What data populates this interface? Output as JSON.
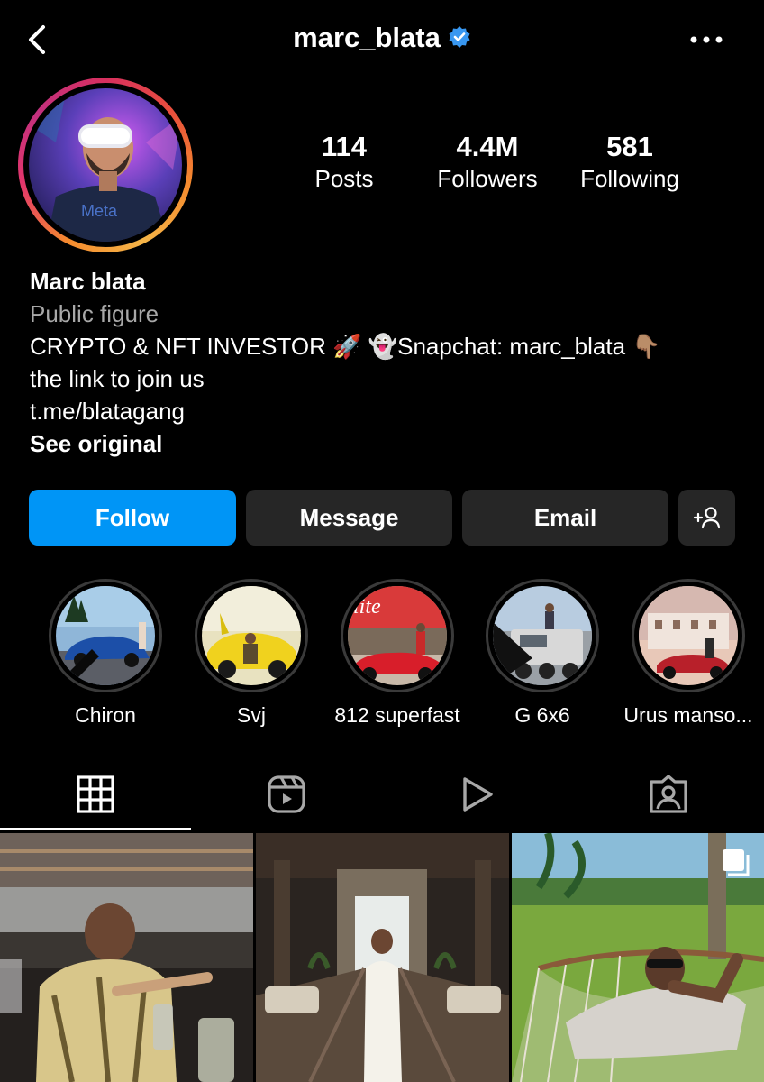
{
  "header": {
    "username": "marc_blata",
    "back_icon": "chevron-left-icon",
    "verified_icon": "verified-badge-icon",
    "more_icon": "more-horizontal-icon",
    "verified_color": "#3897f0"
  },
  "profile": {
    "avatar_ring_colors": [
      "#d8305f",
      "#f58b2e",
      "#f5b548",
      "#c2307e"
    ],
    "avatar_shirt_text": "Meta",
    "stats": [
      {
        "value": "114",
        "label": "Posts"
      },
      {
        "value": "4.4M",
        "label": "Followers"
      },
      {
        "value": "581",
        "label": "Following"
      }
    ],
    "name": "Marc blata",
    "category": "Public figure",
    "bio_line1": "CRYPTO & NFT INVESTOR 🚀  👻Snapchat: marc_blata 👇🏽",
    "bio_line2": "the link to join us",
    "link": "t.me/blatagang",
    "see_original": "See original"
  },
  "actions": {
    "follow": "Follow",
    "message": "Message",
    "email": "Email",
    "add_user_icon": "add-person-icon",
    "follow_color": "#0095f6",
    "secondary_color": "#262626"
  },
  "highlights": [
    {
      "label": "Chiron"
    },
    {
      "label": "Svj"
    },
    {
      "label": "812 superfast"
    },
    {
      "label": "G 6x6"
    },
    {
      "label": "Urus manso..."
    }
  ],
  "highlight_image_text": {
    "elite_sign": "lite"
  },
  "tabs": [
    {
      "icon": "grid-icon",
      "active": true
    },
    {
      "icon": "reels-icon",
      "active": false
    },
    {
      "icon": "play-icon",
      "active": false
    },
    {
      "icon": "tagged-person-icon",
      "active": false
    }
  ],
  "posts": [
    {
      "scene": "restaurant-dining"
    },
    {
      "scene": "lobby-white-outfit"
    },
    {
      "scene": "hammock-lawn",
      "multi_icon": "carousel-icon"
    }
  ]
}
